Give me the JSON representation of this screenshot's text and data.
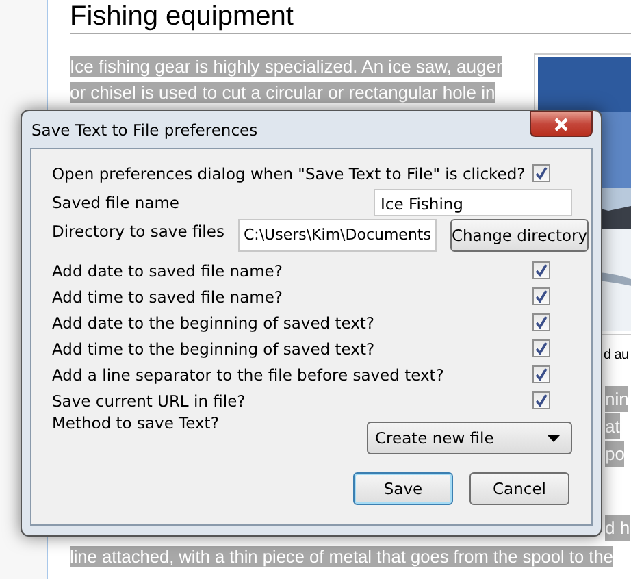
{
  "page": {
    "heading": "Fishing equipment",
    "paragraph_lines": [
      "Ice fishing gear is highly specialized. An ice saw, auger",
      "or chisel is used to cut a circular or rectangular hole in"
    ],
    "caption_fragment": "d au",
    "side_fragments": [
      "nin",
      "at",
      "po",
      "d h"
    ],
    "bottom_line": "line attached, with a thin piece of metal that goes from the spool to the"
  },
  "dialog": {
    "title": "Save Text to File preferences",
    "rows": [
      {
        "kind": "checkbox",
        "label": "Open preferences dialog when \"Save Text to File\" is clicked?",
        "checked": true
      },
      {
        "kind": "text",
        "label": "Saved file name",
        "value": "Ice Fishing"
      },
      {
        "kind": "directory",
        "label": "Directory to save files",
        "value": "C:\\Users\\Kim\\Documents",
        "button": "Change directory"
      },
      {
        "kind": "checkbox",
        "label": "Add date to saved file name?",
        "checked": true
      },
      {
        "kind": "checkbox",
        "label": "Add time to saved file name?",
        "checked": true
      },
      {
        "kind": "checkbox",
        "label": "Add date to the beginning of saved text?",
        "checked": true
      },
      {
        "kind": "checkbox",
        "label": "Add time to the beginning of saved text?",
        "checked": true
      },
      {
        "kind": "checkbox",
        "label": "Add a line separator to the file before saved text?",
        "checked": true
      },
      {
        "kind": "checkbox",
        "label": "Save current URL in file?",
        "checked": true
      },
      {
        "kind": "select",
        "label": "Method to save Text?",
        "value": "Create new file"
      }
    ],
    "buttons": [
      {
        "label": "Save",
        "default": true
      },
      {
        "label": "Cancel",
        "default": false
      }
    ]
  }
}
